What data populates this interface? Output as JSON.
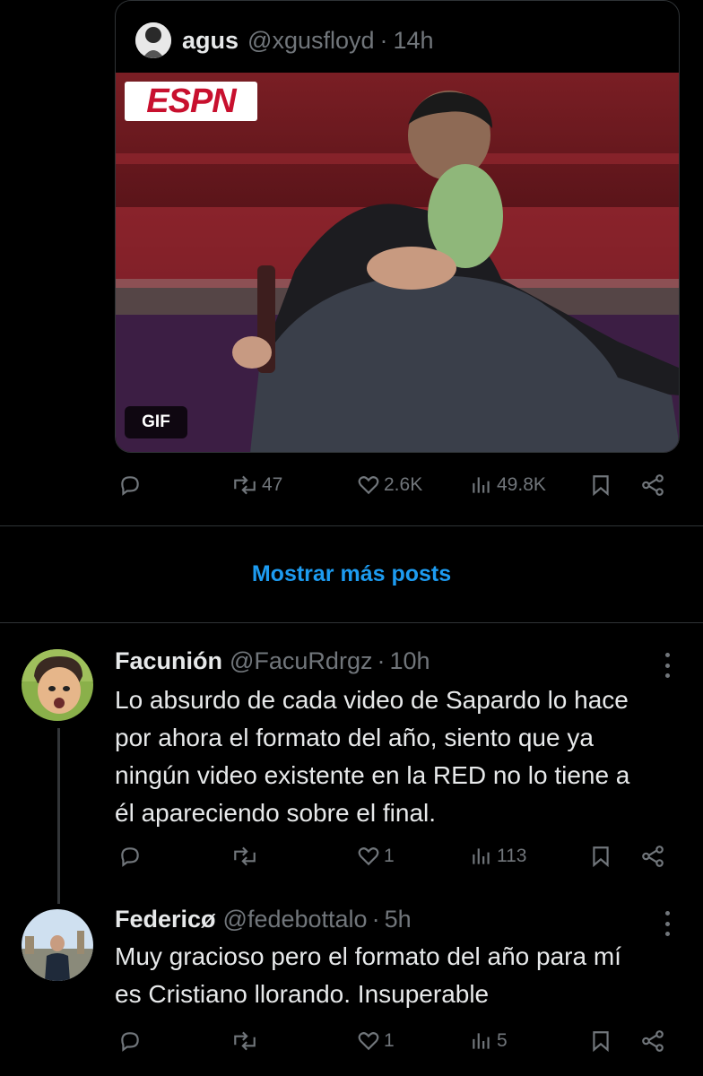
{
  "quoted": {
    "name": "agus",
    "handle": "@xgusfloyd",
    "time": "14h",
    "media_brand": "ESPN",
    "gif_badge": "GIF"
  },
  "main_actions": {
    "reposts": "47",
    "likes": "2.6K",
    "views": "49.8K"
  },
  "show_more": "Mostrar más posts",
  "replies": [
    {
      "name": "Facunión",
      "handle": "@FacuRdrgz",
      "time": "10h",
      "text_lines": [
        "Lo absurdo de cada video de Sapardo lo hace",
        "por ahora el formato del año, siento que ya",
        "ningún video existente en la RED no lo tiene a",
        "él apareciendo sobre el final."
      ],
      "likes": "1",
      "views": "113"
    },
    {
      "name": "Federicø",
      "handle": "@fedebottalo",
      "time": "5h",
      "text_lines": [
        "Muy gracioso pero el formato del año para mí",
        "es Cristiano llorando. Insuperable"
      ],
      "likes": "1",
      "views": "5"
    }
  ],
  "meta_separator": "·",
  "colors": {
    "background": "#000000",
    "text": "#e7e9ea",
    "muted": "#71767b",
    "accent": "#1d9bf0",
    "border": "#2f3336"
  }
}
